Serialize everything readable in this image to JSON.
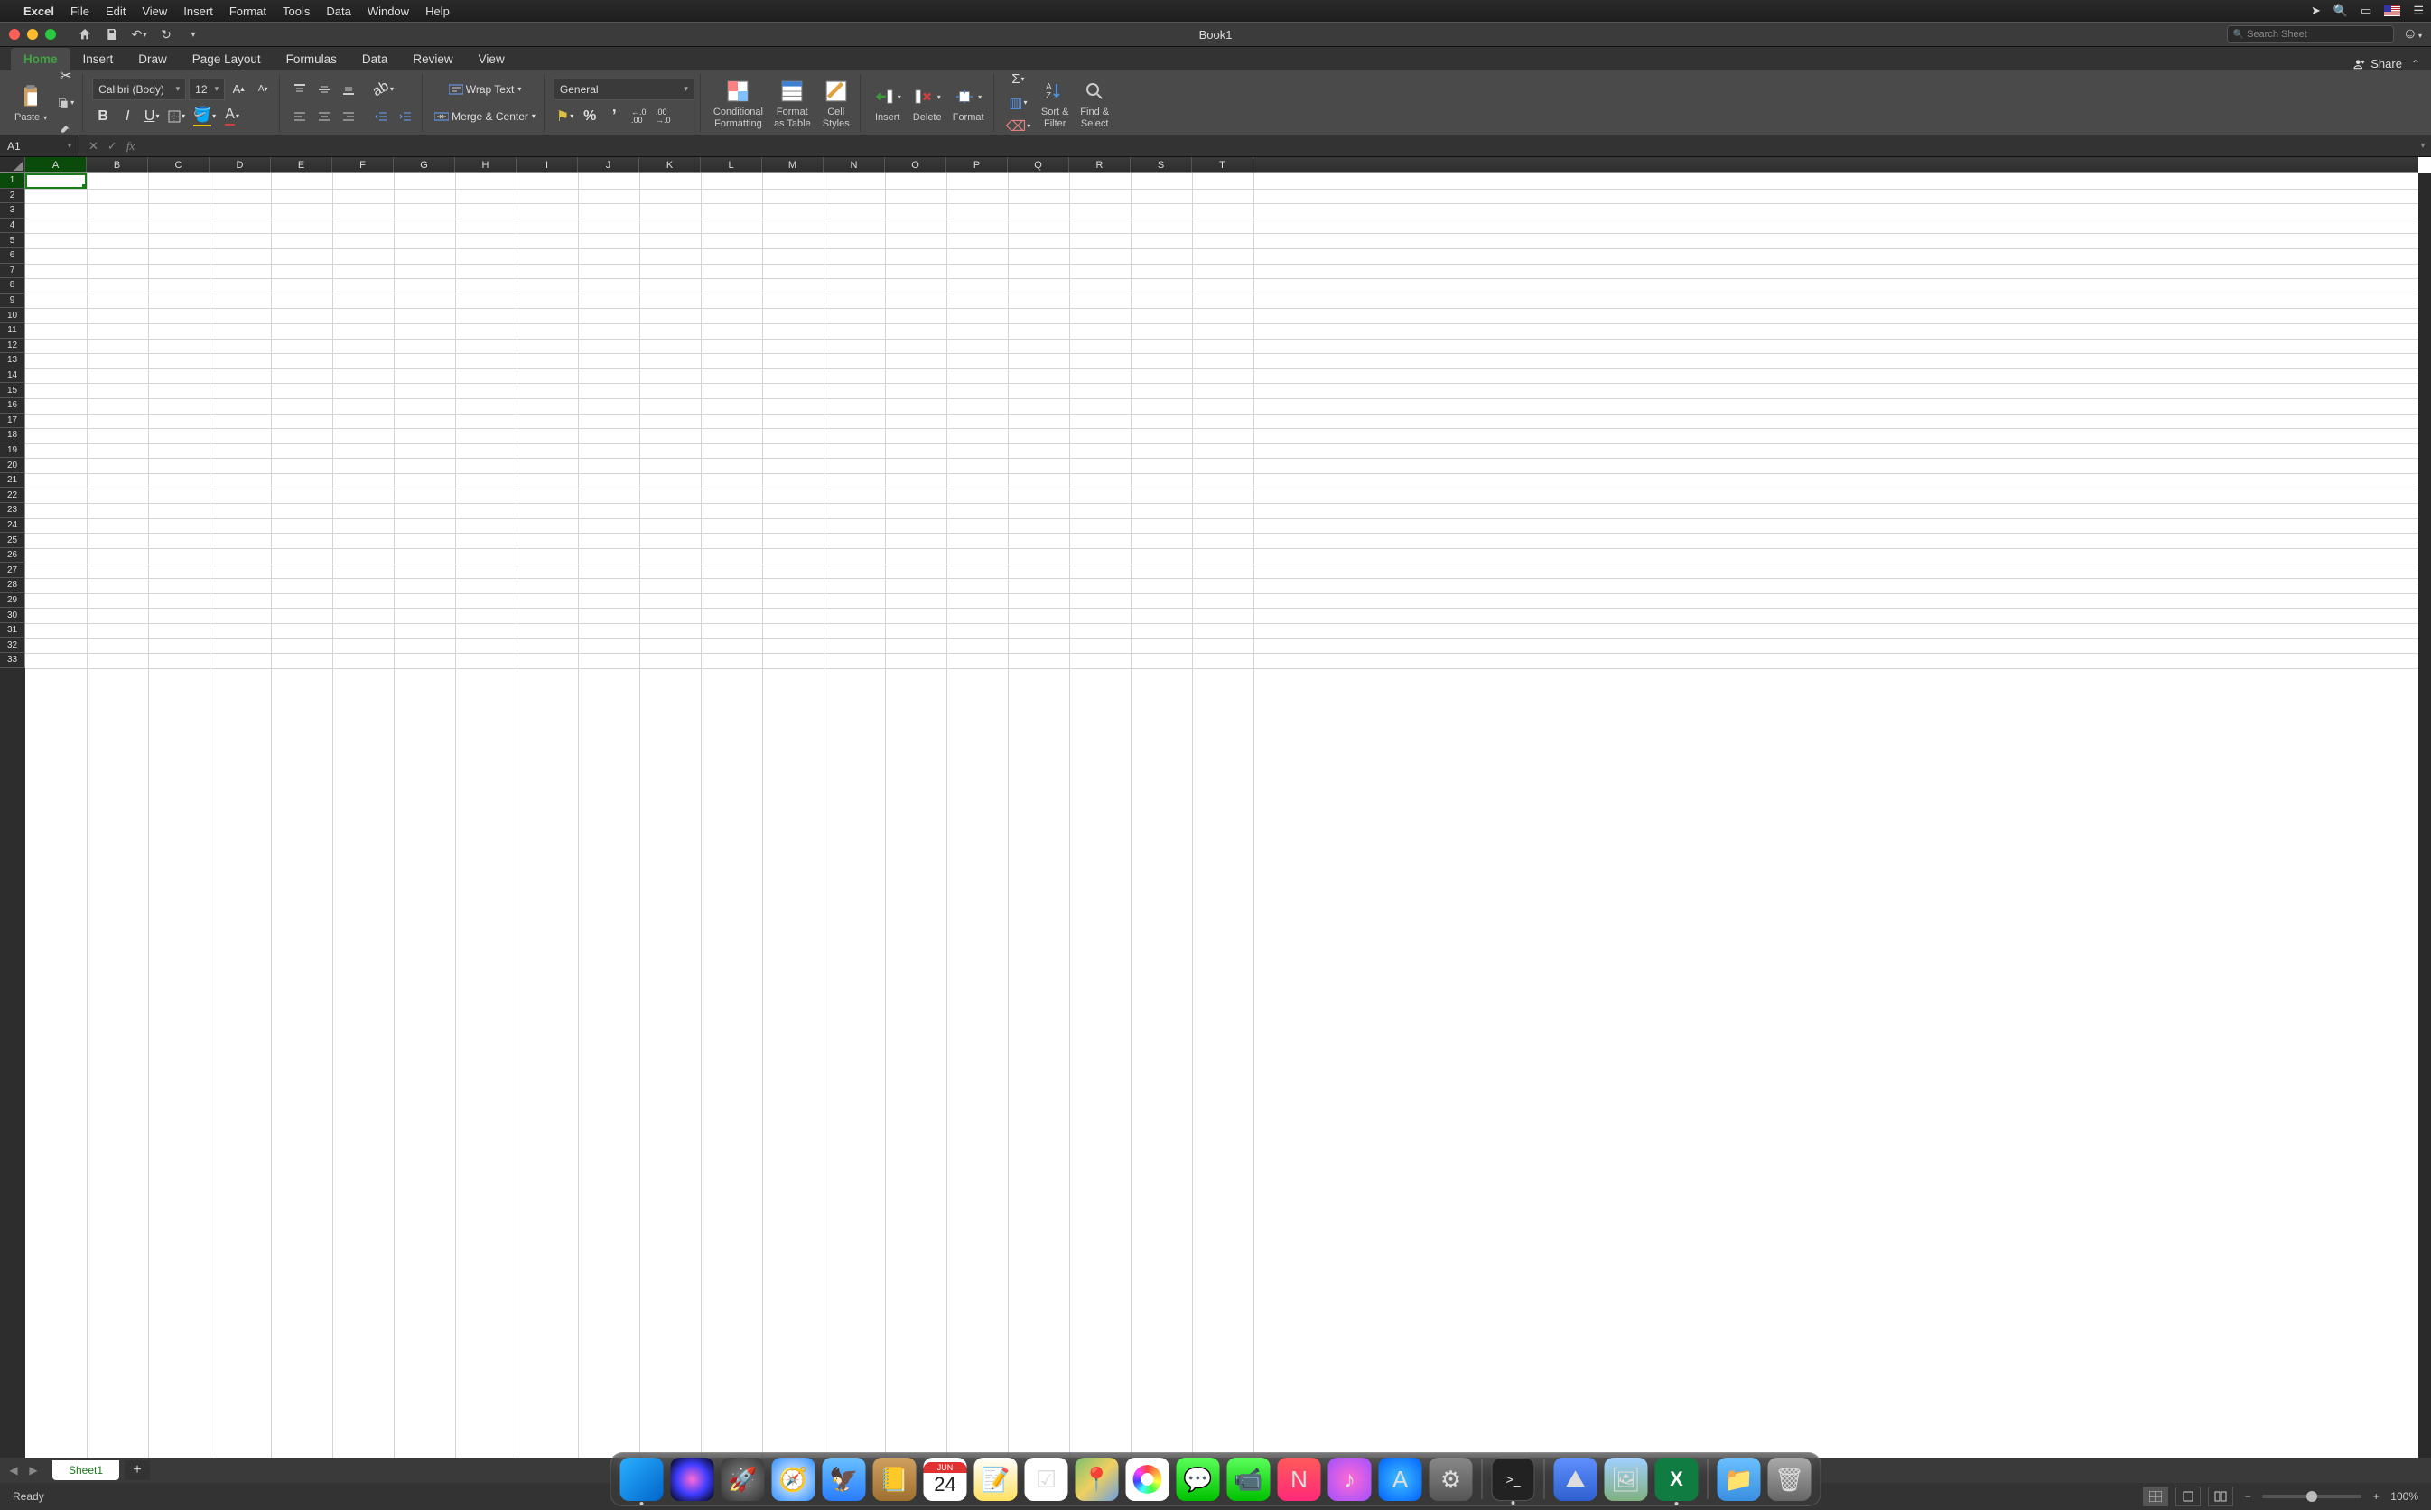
{
  "mac_menu": {
    "app": "Excel",
    "items": [
      "File",
      "Edit",
      "View",
      "Insert",
      "Format",
      "Tools",
      "Data",
      "Window",
      "Help"
    ]
  },
  "titlebar": {
    "title": "Book1",
    "search_placeholder": "Search Sheet"
  },
  "ribbon_tabs": [
    "Home",
    "Insert",
    "Draw",
    "Page Layout",
    "Formulas",
    "Data",
    "Review",
    "View"
  ],
  "ribbon_active_tab": "Home",
  "ribbon_right": {
    "share": "Share"
  },
  "ribbon": {
    "paste": "Paste",
    "font_name": "Calibri (Body)",
    "font_size": "12",
    "number_format": "General",
    "wrap_text": "Wrap Text",
    "merge_center": "Merge & Center",
    "cond_fmt_l1": "Conditional",
    "cond_fmt_l2": "Formatting",
    "fmt_table_l1": "Format",
    "fmt_table_l2": "as Table",
    "cell_styles_l1": "Cell",
    "cell_styles_l2": "Styles",
    "insert": "Insert",
    "delete": "Delete",
    "format": "Format",
    "sort_l1": "Sort &",
    "sort_l2": "Filter",
    "find_l1": "Find &",
    "find_l2": "Select"
  },
  "formula_bar": {
    "name_box": "A1",
    "formula": ""
  },
  "grid": {
    "columns": [
      "A",
      "B",
      "C",
      "D",
      "E",
      "F",
      "G",
      "H",
      "I",
      "J",
      "K",
      "L",
      "M",
      "N",
      "O",
      "P",
      "Q",
      "R",
      "S",
      "T"
    ],
    "rows": [
      1,
      2,
      3,
      4,
      5,
      6,
      7,
      8,
      9,
      10,
      11,
      12,
      13,
      14,
      15,
      16,
      17,
      18,
      19,
      20,
      21,
      22,
      23,
      24,
      25,
      26,
      27,
      28,
      29,
      30,
      31,
      32,
      33
    ],
    "selected_cell": "A1"
  },
  "sheet_tabs": {
    "active": "Sheet1",
    "tabs": [
      "Sheet1"
    ]
  },
  "statusbar": {
    "status": "Ready",
    "zoom": "100%"
  },
  "calendar": {
    "month": "JUN",
    "day": "24"
  },
  "dock_apps": [
    "finder",
    "siri",
    "launchpad",
    "safari",
    "mail",
    "contacts",
    "calendar",
    "notes",
    "reminders",
    "maps",
    "photos",
    "messages",
    "facetime",
    "news",
    "itunes",
    "appstore",
    "preferences",
    "terminal",
    "screenshot",
    "image",
    "excel",
    "folder",
    "trash"
  ]
}
